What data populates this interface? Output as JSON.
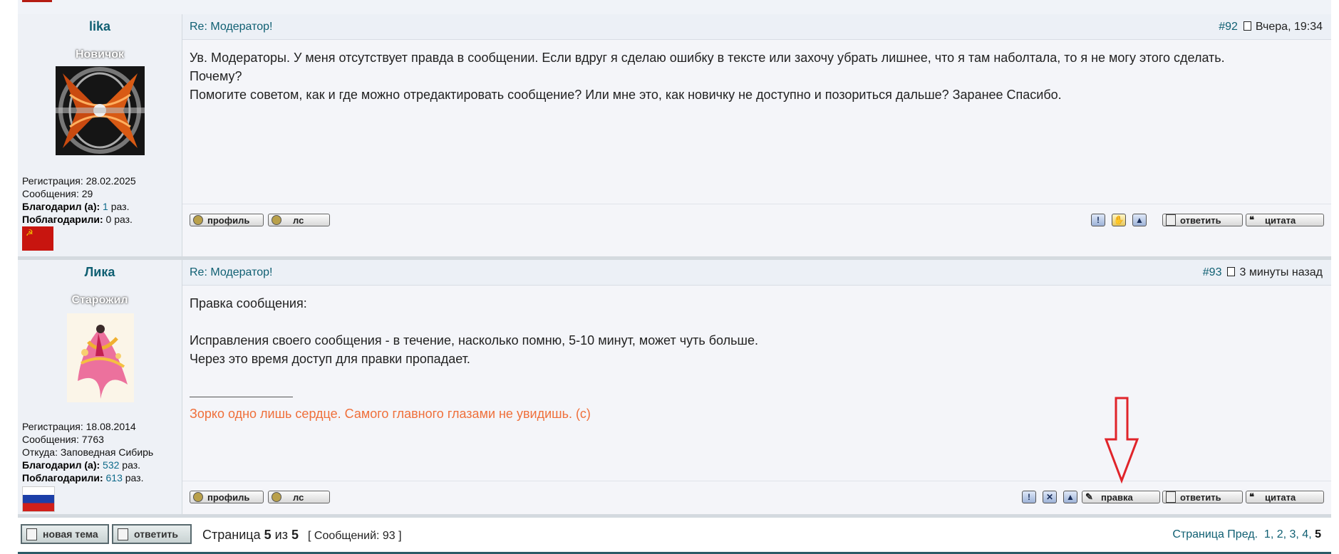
{
  "posts": [
    {
      "username": "lika",
      "rank": "Новичок",
      "registration": "Регистрация: 28.02.2025",
      "messages": "Сообщения: 29",
      "thanked_label": "Благодарил (а):",
      "thanked_count": "1",
      "thanked_suffix": "раз.",
      "thanked_by_label": "Поблагодарили:",
      "thanked_by_count": "0",
      "thanked_by_suffix": "раз.",
      "subject": "Re: Модератор!",
      "post_number": "#92",
      "timestamp": "Вчера, 19:34",
      "body": [
        "Ув. Модераторы. У меня отсутствует правда в сообщении. Если вдруг я сделаю ошибку в тексте или захочу убрать лишнее, что я там наболтала, то я не могу этого сделать.",
        "Почему?",
        "Помогите советом, как и где можно отредактировать сообщение? Или мне это, как новичку не доступно и позориться дальше? Заранее Спасибо."
      ],
      "buttons": {
        "profile": "профиль",
        "pm": "лс",
        "reply": "ответить",
        "quote": "цитата"
      },
      "icons": [
        "report-icon",
        "thanks-icon",
        "top-icon"
      ]
    },
    {
      "username": "Лика",
      "rank": "Старожил",
      "registration": "Регистрация: 18.08.2014",
      "messages": "Сообщения: 7763",
      "location": "Откуда: Заповедная Сибирь",
      "thanked_label": "Благодарил (а):",
      "thanked_count": "532",
      "thanked_suffix": "раз.",
      "thanked_by_label": "Поблагодарили:",
      "thanked_by_count": "613",
      "thanked_by_suffix": "раз.",
      "subject": "Re: Модератор!",
      "post_number": "#93",
      "timestamp": "3 минуты назад",
      "body": [
        "Правка сообщения:",
        "",
        "Исправления своего сообщения - в течение, насколько помню, 5-10 минут, может чуть больше.",
        "Через это время доступ для правки пропадает."
      ],
      "signature": "Зорко одно лишь сердце. Самого главного глазами не увидишь. (с)",
      "buttons": {
        "profile": "профиль",
        "pm": "лс",
        "edit": "правка",
        "reply": "ответить",
        "quote": "цитата"
      },
      "icons": [
        "report-icon",
        "delete-icon",
        "top-icon"
      ]
    }
  ],
  "footer": {
    "new_topic": "новая тема",
    "reply": "ответить",
    "page_word": "Страница",
    "page_current": "5",
    "of_word": "из",
    "page_total": "5",
    "messages_count": "[ Сообщений: 93 ]",
    "pager_label": "Страница Пред.",
    "pages": [
      "1",
      "2",
      "3",
      "4",
      "5"
    ]
  },
  "colors": {
    "link": "#0f5f72",
    "signature": "#ef6f3a",
    "annotation_arrow": "#e0242a"
  }
}
